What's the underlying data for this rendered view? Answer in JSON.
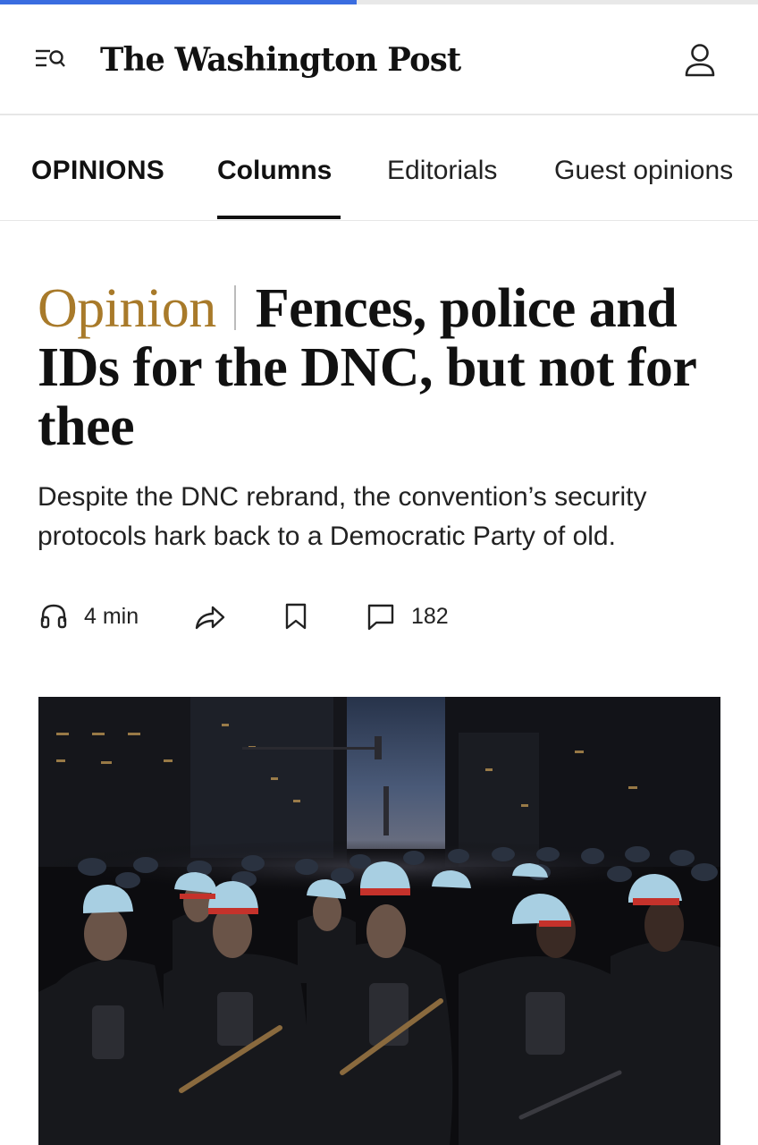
{
  "reading_progress": 0.47,
  "header": {
    "logo_text": "The Washington Post",
    "menu_icon": "menu-search-icon",
    "account_icon": "person-icon"
  },
  "nav": {
    "section": "OPINIONS",
    "tabs": [
      {
        "label": "Columns",
        "active": true
      },
      {
        "label": "Editorials"
      },
      {
        "label": "Guest opinions"
      }
    ]
  },
  "article": {
    "kicker": "Opinion",
    "headline": "Fences, police and IDs for the DNC, but not for thee",
    "dek": "Despite the DNC rebrand, the convention’s security protocols hark back to a Democratic Party of old.",
    "actions": {
      "listen_label": "4 min",
      "comment_count": "182",
      "listen_icon": "headphones-icon",
      "share_icon": "share-icon",
      "save_icon": "bookmark-icon",
      "comment_icon": "comment-icon"
    },
    "image": {
      "subject": "Rows of police officers in riot helmets holding batons on a city street at dusk"
    }
  },
  "colors": {
    "progress": "#3a6de0",
    "kicker": "#a87a2a",
    "text": "#111111",
    "helmet": "#a8cfe2",
    "helmet_band": "#c5322b"
  }
}
